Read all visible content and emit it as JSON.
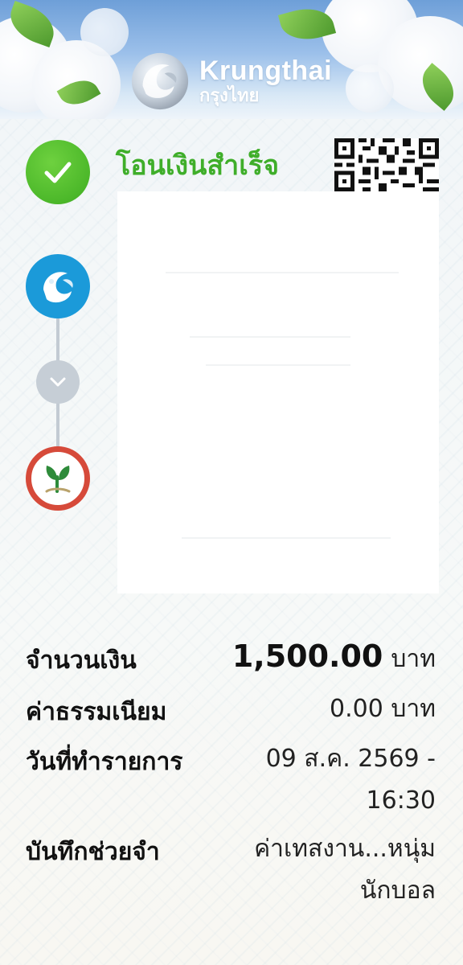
{
  "brand": {
    "name_en": "Krungthai",
    "name_th": "กรุงไทย"
  },
  "status": {
    "title": "โอนเงินสำเร็จ",
    "icon": "check-icon",
    "color": "#4cb82a"
  },
  "transfer": {
    "from_bank_icon": "krungthai-bank-icon",
    "arrow_icon": "chevron-down-icon",
    "to_bank_icon": "kasikorn-bank-icon"
  },
  "details": {
    "amount_label": "จำนวนเงิน",
    "amount_value": "1,500.00",
    "amount_unit": "บาท",
    "fee_label": "ค่าธรรมเนียม",
    "fee_value": "0.00 บาท",
    "date_label": "วันที่ทำรายการ",
    "date_value": "09 ส.ค. 2569 -",
    "time_value": "16:30",
    "memo_label": "บันทึกช่วยจำ",
    "memo_line1": "ค่าเทสงาน...หนุ่ม",
    "memo_line2": "นักบอล"
  },
  "colors": {
    "success": "#4cb82a",
    "krungthai_blue": "#1b9ad9",
    "kbank_red": "#d64a3a",
    "kbank_green": "#2e8b3a"
  }
}
